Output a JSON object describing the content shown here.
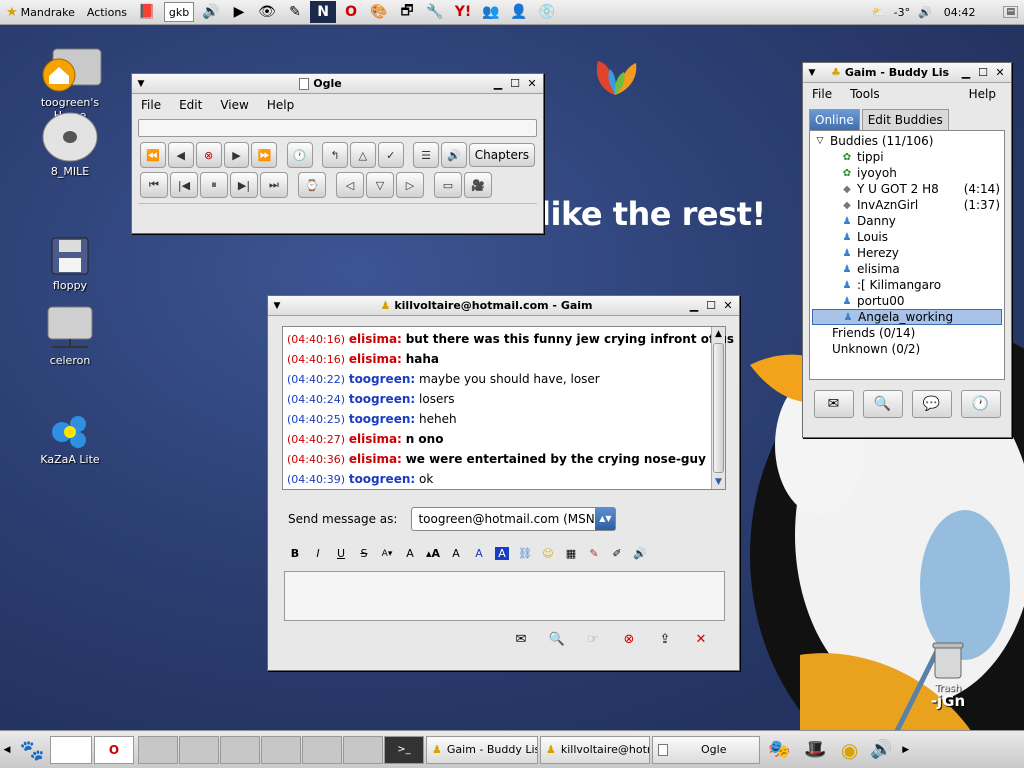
{
  "top_panel": {
    "menu_main": "Mandrake",
    "menu_actions": "Actions",
    "keyboard_applet": "gkb",
    "weather": "-3°",
    "clock": "04:42"
  },
  "desktop": {
    "slogan": "like the rest!",
    "icons": [
      {
        "label": "toogreen's Home"
      },
      {
        "label": "8_MILE"
      },
      {
        "label": "floppy"
      },
      {
        "label": "celeron"
      },
      {
        "label": "KaZaA Lite"
      }
    ],
    "trash": "Trash",
    "signature": "-jGn"
  },
  "ogle": {
    "title": "Ogle",
    "menu": [
      "File",
      "Edit",
      "View",
      "Help"
    ],
    "chapters_label": "Chapters"
  },
  "buddy_list": {
    "title": "Gaim - Buddy Lis",
    "menu": [
      "File",
      "Tools",
      "Help"
    ],
    "tabs": [
      "Online",
      "Edit Buddies"
    ],
    "groups": [
      {
        "name": "Buddies (11/106)"
      },
      {
        "name": "Friends (0/14)"
      },
      {
        "name": "Unknown (0/2)"
      }
    ],
    "buddies": [
      {
        "name": "tippi",
        "idle": ""
      },
      {
        "name": "iyoyoh",
        "idle": ""
      },
      {
        "name": "Y U GOT 2 H8",
        "idle": "(4:14)"
      },
      {
        "name": "InvAznGirl",
        "idle": "(1:37)"
      },
      {
        "name": "Danny",
        "idle": ""
      },
      {
        "name": "Louis",
        "idle": ""
      },
      {
        "name": "Herezy",
        "idle": ""
      },
      {
        "name": "elisima",
        "idle": ""
      },
      {
        "name": ":[ Kilimangaro",
        "idle": ""
      },
      {
        "name": "portu00",
        "idle": ""
      },
      {
        "name": "Angela_working",
        "idle": ""
      }
    ]
  },
  "conversation": {
    "title": "killvoltaire@hotmail.com - Gaim",
    "messages": [
      {
        "time": "(04:40:16)",
        "nick": "elisima:",
        "text": "but there was this funny jew crying infront of us"
      },
      {
        "time": "(04:40:16)",
        "nick": "elisima:",
        "text": "haha"
      },
      {
        "time": "(04:40:22)",
        "nick": "toogreen:",
        "text": "maybe you should have, loser"
      },
      {
        "time": "(04:40:24)",
        "nick": "toogreen:",
        "text": "losers"
      },
      {
        "time": "(04:40:25)",
        "nick": "toogreen:",
        "text": "heheh"
      },
      {
        "time": "(04:40:27)",
        "nick": "elisima:",
        "text": "n ono"
      },
      {
        "time": "(04:40:36)",
        "nick": "elisima:",
        "text": "we were entertained by the crying nose-guy"
      },
      {
        "time": "(04:40:39)",
        "nick": "toogreen:",
        "text": "ok"
      }
    ],
    "send_as_label": "Send message as:",
    "account": "toogreen@hotmail.com (MSN)",
    "entry_text": ""
  },
  "taskbar": {
    "tasks": [
      "Gaim - Buddy List",
      "killvoltaire@hotma",
      "Ogle"
    ]
  },
  "colors": {
    "remote_nick": "#cc0000",
    "local_nick": "#1a3cc2",
    "selection": "#a8c3e7",
    "tab_active": "#4f7dbf"
  }
}
